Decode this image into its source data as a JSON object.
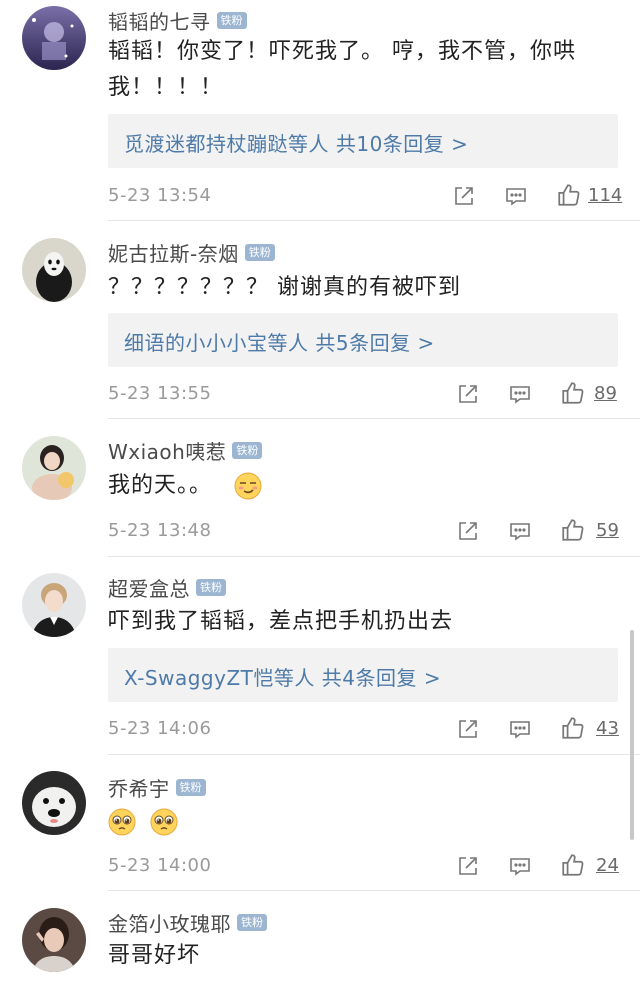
{
  "comments": [
    {
      "username": "韬韬的七寻",
      "badge": "铁粉",
      "content": "韬韬！你变了！吓死我了。 哼，你不管，你哄我！！！！",
      "content_line1": "韬韬！你变了！吓死我了。 哼，我不管，你哄",
      "content_line2": "我！！！！",
      "reply_summary": "觅渡迷都持杖蹦跶等人  共10条回复 >",
      "time": "5-23 13:54",
      "likes": "114"
    },
    {
      "username": "妮古拉斯-奈烟",
      "badge": "铁粉",
      "content": "？？？？？？？ 谢谢真的有被吓到",
      "reply_summary": "细语的小小小宝等人  共5条回复 >",
      "time": "5-23 13:55",
      "likes": "89"
    },
    {
      "username": "Wxiaoh咦惹",
      "badge": "铁粉",
      "content": "我的天。。",
      "time": "5-23 13:48",
      "likes": "59"
    },
    {
      "username": "超爱盒总",
      "badge": "铁粉",
      "content": "吓到我了韬韬，差点把手机扔出去",
      "reply_summary": "X-SwaggyZT恺等人  共4条回复 >",
      "time": "5-23 14:06",
      "likes": "43"
    },
    {
      "username": "乔希宇",
      "badge": "铁粉",
      "content": "",
      "time": "5-23 14:00",
      "likes": "24"
    },
    {
      "username": "金箔小玫瑰耶",
      "badge": "铁粉",
      "content": "哥哥好坏"
    }
  ],
  "icons": {
    "share": "share-icon",
    "comment": "comment-icon",
    "like": "thumbs-up-icon",
    "emoji_smug": "smug-face-emoji",
    "emoji_pleading": "pleading-face-emoji"
  },
  "colors": {
    "link": "#4d7aa8",
    "badge": "#9cb6d2",
    "reply_bg": "#f2f2f2",
    "time": "#9a9a9a"
  }
}
